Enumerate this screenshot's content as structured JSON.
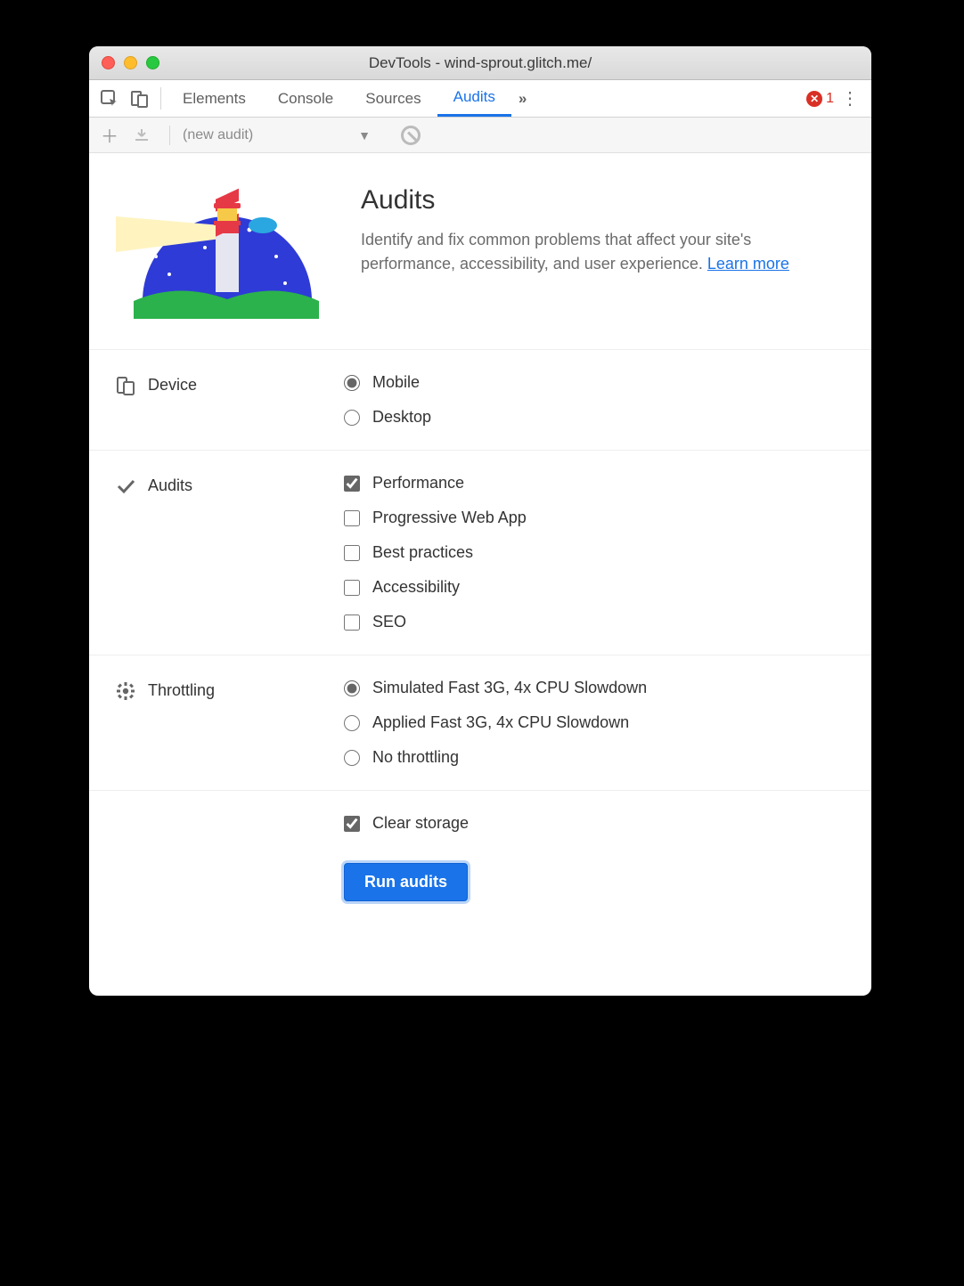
{
  "window": {
    "title": "DevTools - wind-sprout.glitch.me/"
  },
  "tabs": {
    "items": [
      "Elements",
      "Console",
      "Sources",
      "Audits"
    ],
    "active": 3,
    "overflow": "»",
    "error_count": "1"
  },
  "subtoolbar": {
    "audit_label": "(new audit)"
  },
  "intro": {
    "heading": "Audits",
    "body": "Identify and fix common problems that affect your site's performance, accessibility, and user experience. ",
    "link": "Learn more"
  },
  "device": {
    "label": "Device",
    "options": [
      {
        "label": "Mobile",
        "checked": true
      },
      {
        "label": "Desktop",
        "checked": false
      }
    ]
  },
  "audits": {
    "label": "Audits",
    "options": [
      {
        "label": "Performance",
        "checked": true
      },
      {
        "label": "Progressive Web App",
        "checked": false
      },
      {
        "label": "Best practices",
        "checked": false
      },
      {
        "label": "Accessibility",
        "checked": false
      },
      {
        "label": "SEO",
        "checked": false
      }
    ]
  },
  "throttling": {
    "label": "Throttling",
    "options": [
      {
        "label": "Simulated Fast 3G, 4x CPU Slowdown",
        "checked": true
      },
      {
        "label": "Applied Fast 3G, 4x CPU Slowdown",
        "checked": false
      },
      {
        "label": "No throttling",
        "checked": false
      }
    ]
  },
  "clear_storage": {
    "label": "Clear storage",
    "checked": true
  },
  "run_button": "Run audits"
}
